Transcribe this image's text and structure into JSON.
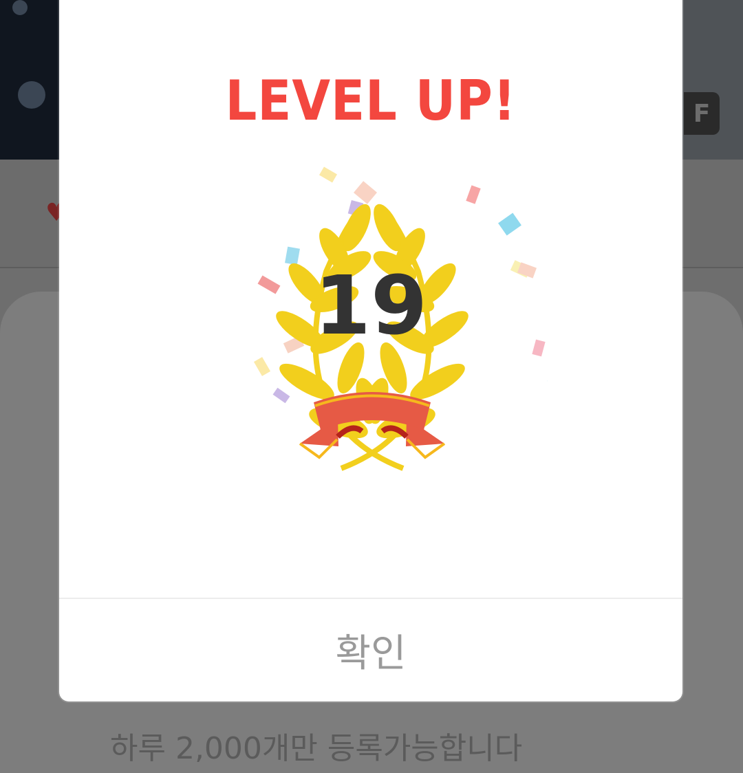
{
  "background": {
    "badge_text": "F",
    "heart_icon": "heart-icon",
    "notice_text": "하루 2,000개만 등록가능합니다"
  },
  "dialog": {
    "title": "LEVEL UP!",
    "level": "19",
    "emblem_icon": "laurel-wreath-ribbon-icon",
    "confirm_label": "확인"
  },
  "colors": {
    "title": "#f3473f",
    "level": "#333333",
    "laurel": "#f2cf1d",
    "ribbon": "#e65a45",
    "ribbon_stripe": "#f6b81d",
    "confirm_text": "#9a9a9a",
    "overlay": "#6e6e6e"
  }
}
